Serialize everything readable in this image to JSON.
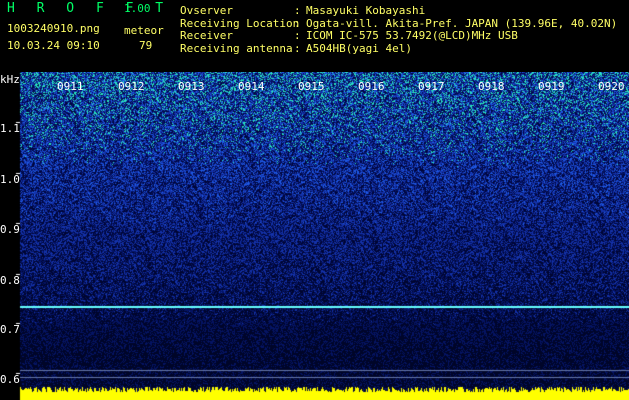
{
  "header": {
    "app_title": "H R O F F T",
    "version": "1.00",
    "filename": "1003240910.png",
    "date": "10.03.24 09:10",
    "meteor_label": "meteor",
    "meteor_count": "79"
  },
  "info": [
    {
      "key": "Ovserver",
      "value": "Masayuki Kobayashi"
    },
    {
      "key": "Receiving Location",
      "value": "Ogata-vill. Akita-Pref. JAPAN (139.96E, 40.02N)"
    },
    {
      "key": "Receiver",
      "value": "ICOM IC-575 53.7492(@LCD)MHz USB"
    },
    {
      "key": "Receiving antenna",
      "value": "A504HB(yagi 4el)"
    }
  ],
  "spectrogram": {
    "y_unit": "kHz",
    "y_ticks": [
      "1.1",
      "1.0",
      "0.9",
      "0.8",
      "0.7",
      "0.6"
    ],
    "time_ticks": [
      "0911",
      "0912",
      "0913",
      "0914",
      "0915",
      "0916",
      "0917",
      "0918",
      "0919",
      "0920"
    ],
    "colors": {
      "background": "#000000",
      "high": "#00ffcc",
      "mid": "#1e4bd0",
      "low": "#001060",
      "trace": "#66ffff",
      "bottom_band": "#ffff00"
    }
  }
}
